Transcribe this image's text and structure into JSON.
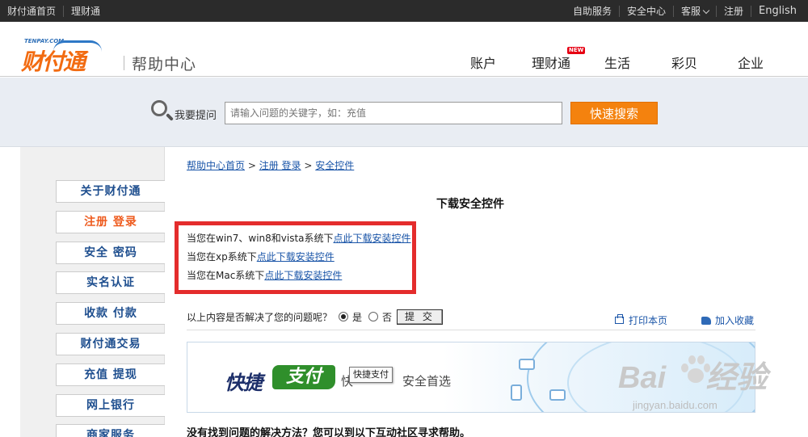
{
  "topbar": {
    "left_links": [
      "财付通首页",
      "理财通"
    ],
    "right_links": [
      "自助服务",
      "安全中心",
      "客服",
      "注册",
      "English"
    ]
  },
  "header": {
    "logo_small": "TENPAY.COM",
    "logo_text": "财付通",
    "help_center": "帮助中心",
    "nav": [
      "账户",
      "理财通",
      "生活",
      "彩贝",
      "企业"
    ],
    "new_badge": "NEW"
  },
  "search": {
    "label": "我要提问",
    "placeholder": "请输入问题的关键字，如：充值",
    "button": "快速搜索"
  },
  "sidebar": {
    "items": [
      "关于财付通",
      "注册 登录",
      "安全 密码",
      "实名认证",
      "收款 付款",
      "财付通交易",
      "充值 提现",
      "网上银行",
      "商家服务"
    ],
    "active_index": 1
  },
  "breadcrumb": {
    "home": "帮助中心首页",
    "sep": ">",
    "level1": "注册 登录",
    "level2": "安全控件"
  },
  "content": {
    "title": "下载安全控件",
    "downloads": [
      {
        "prefix": "当您在win7、win8和vista系统下",
        "link": "点此下载安装控件"
      },
      {
        "prefix": "当您在xp系统下",
        "link": "点此下载安装控件"
      },
      {
        "prefix": "当您在Mac系统下",
        "link": "点此下载安装控件"
      }
    ],
    "feedback": {
      "question": "以上内容是否解决了您的问题呢？",
      "yes": "是",
      "no": "否",
      "selected": "是",
      "submit": "提 交"
    },
    "print": "打印本页",
    "favorite": "加入收藏",
    "banner": {
      "kuaijie": "快捷",
      "zhifu": "支付",
      "tooltip": "快捷支付",
      "sub": "快",
      "safe": "安全首选"
    },
    "bottom_text": "没有找到问题的解决方法？您可以到以下互动社区寻求帮助。"
  },
  "watermark": {
    "brand": "Bai",
    "brand2": "经验",
    "url": "jingyan.baidu.com"
  },
  "colors": {
    "accent_orange": "#f4820e",
    "topbar": "#2b2b2b",
    "link": "#1a55a8",
    "highlight_red": "#e42c2c",
    "active_sidebar": "#ee5b1e"
  }
}
